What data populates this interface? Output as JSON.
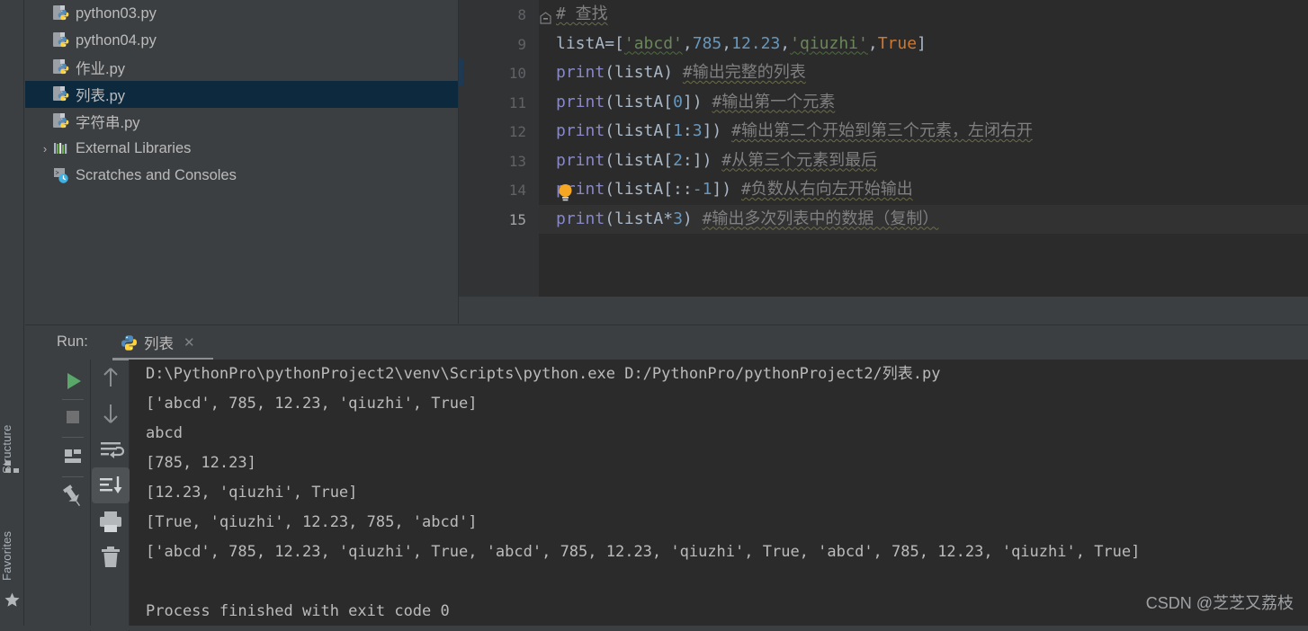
{
  "tool_strip": {
    "structure_label": "Structure",
    "favorites_label": "Favorites",
    "structure_icon": "structure-icon",
    "favorites_icon": "star-icon"
  },
  "project_tree": {
    "items": [
      {
        "label": "python03.py",
        "icon": "python-file-icon",
        "selected": false,
        "arrow": "",
        "indent": 0
      },
      {
        "label": "python04.py",
        "icon": "python-file-icon",
        "selected": false,
        "arrow": "",
        "indent": 0
      },
      {
        "label": "作业.py",
        "icon": "python-file-icon",
        "selected": false,
        "arrow": "",
        "indent": 0
      },
      {
        "label": "列表.py",
        "icon": "python-file-icon",
        "selected": true,
        "arrow": "",
        "indent": 0
      },
      {
        "label": "字符串.py",
        "icon": "python-file-icon",
        "selected": false,
        "arrow": "",
        "indent": 0
      },
      {
        "label": "External Libraries",
        "icon": "library-icon",
        "selected": false,
        "arrow": "›",
        "indent": 0
      },
      {
        "label": "Scratches and Consoles",
        "icon": "scratches-icon",
        "selected": false,
        "arrow": "",
        "indent": 0
      }
    ]
  },
  "editor": {
    "line_numbers": [
      "8",
      "9",
      "10",
      "11",
      "12",
      "13",
      "14",
      "15"
    ],
    "current_line": "15",
    "lines": [
      {
        "number": "8",
        "fold": true,
        "tokens": [
          {
            "t": "# 查找",
            "c": "k-cmt"
          }
        ]
      },
      {
        "number": "9",
        "fold": false,
        "tokens": [
          {
            "t": "listA",
            "c": "k-var"
          },
          {
            "t": "=",
            "c": "k-op"
          },
          {
            "t": "[",
            "c": "k-brk"
          },
          {
            "t": "'abcd'",
            "c": "k-str"
          },
          {
            "t": ",",
            "c": "k-op"
          },
          {
            "t": "785",
            "c": "k-num"
          },
          {
            "t": ",",
            "c": "k-op"
          },
          {
            "t": "12.23",
            "c": "k-num"
          },
          {
            "t": ",",
            "c": "k-op"
          },
          {
            "t": "'qiuzhi'",
            "c": "k-str"
          },
          {
            "t": ",",
            "c": "k-op"
          },
          {
            "t": "True",
            "c": "k-kw"
          },
          {
            "t": "]",
            "c": "k-brk"
          }
        ]
      },
      {
        "number": "10",
        "fold": false,
        "tokens": [
          {
            "t": "print",
            "c": "k-fn"
          },
          {
            "t": "(",
            "c": "k-brk"
          },
          {
            "t": "listA",
            "c": "k-var"
          },
          {
            "t": ")",
            "c": "k-brk"
          },
          {
            "t": " ",
            "c": "k-op"
          },
          {
            "t": "#输出完整的列表",
            "c": "k-cmt"
          }
        ]
      },
      {
        "number": "11",
        "fold": false,
        "tokens": [
          {
            "t": "print",
            "c": "k-fn"
          },
          {
            "t": "(",
            "c": "k-brk"
          },
          {
            "t": "listA",
            "c": "k-var"
          },
          {
            "t": "[",
            "c": "k-brk"
          },
          {
            "t": "0",
            "c": "k-num"
          },
          {
            "t": "])",
            "c": "k-brk"
          },
          {
            "t": " ",
            "c": "k-op"
          },
          {
            "t": "#输出第一个元素",
            "c": "k-cmt"
          }
        ]
      },
      {
        "number": "12",
        "fold": false,
        "tokens": [
          {
            "t": "print",
            "c": "k-fn"
          },
          {
            "t": "(",
            "c": "k-brk"
          },
          {
            "t": "listA",
            "c": "k-var"
          },
          {
            "t": "[",
            "c": "k-brk"
          },
          {
            "t": "1",
            "c": "k-num"
          },
          {
            "t": ":",
            "c": "k-op"
          },
          {
            "t": "3",
            "c": "k-num"
          },
          {
            "t": "])",
            "c": "k-brk"
          },
          {
            "t": " ",
            "c": "k-op"
          },
          {
            "t": "#输出第二个开始到第三个元素，左闭右开",
            "c": "k-cmt"
          }
        ]
      },
      {
        "number": "13",
        "fold": false,
        "tokens": [
          {
            "t": "print",
            "c": "k-fn"
          },
          {
            "t": "(",
            "c": "k-brk"
          },
          {
            "t": "listA",
            "c": "k-var"
          },
          {
            "t": "[",
            "c": "k-brk"
          },
          {
            "t": "2",
            "c": "k-num"
          },
          {
            "t": ":])",
            "c": "k-brk"
          },
          {
            "t": " ",
            "c": "k-op"
          },
          {
            "t": "#从第三个元素到最后",
            "c": "k-cmt"
          }
        ]
      },
      {
        "number": "14",
        "fold": false,
        "tokens": [
          {
            "t": "print",
            "c": "k-fn"
          },
          {
            "t": "(",
            "c": "k-brk"
          },
          {
            "t": "listA",
            "c": "k-var"
          },
          {
            "t": "[::",
            "c": "k-brk"
          },
          {
            "t": "-1",
            "c": "k-num"
          },
          {
            "t": "])",
            "c": "k-brk"
          },
          {
            "t": " ",
            "c": "k-op"
          },
          {
            "t": "#负数从右向左开始输出",
            "c": "k-cmt"
          }
        ]
      },
      {
        "number": "15",
        "fold": false,
        "tokens": [
          {
            "t": "print",
            "c": "k-fn"
          },
          {
            "t": "(",
            "c": "k-brk"
          },
          {
            "t": "listA",
            "c": "k-var"
          },
          {
            "t": "*",
            "c": "k-op"
          },
          {
            "t": "3",
            "c": "k-num"
          },
          {
            "t": ")",
            "c": "k-brk"
          },
          {
            "t": " ",
            "c": "k-op"
          },
          {
            "t": "#输出多次列表中的数据（复制）",
            "c": "k-cmt"
          }
        ]
      }
    ],
    "intention_bulb": "lightbulb-icon"
  },
  "run_panel": {
    "run_label": "Run:",
    "tab_name": "列表",
    "tab_icon": "python-icon",
    "close_icon": "close-icon",
    "toolbar_primary": [
      {
        "name": "rerun-button",
        "icon": "play-icon"
      },
      {
        "name": "stop-button",
        "icon": "stop-icon"
      },
      {
        "name": "restore-layout-button",
        "icon": "layout-icon"
      },
      {
        "name": "pin-tab-button",
        "icon": "pin-icon"
      }
    ],
    "toolbar_secondary": [
      {
        "name": "up-stacktrace-button",
        "icon": "arrow-up-icon"
      },
      {
        "name": "down-stacktrace-button",
        "icon": "arrow-down-icon"
      },
      {
        "name": "soft-wrap-button",
        "icon": "soft-wrap-icon"
      },
      {
        "name": "scroll-to-end-button",
        "icon": "scroll-to-end-icon",
        "active": true
      },
      {
        "name": "print-button",
        "icon": "printer-icon"
      },
      {
        "name": "clear-all-button",
        "icon": "trash-icon"
      }
    ],
    "console_lines": [
      "D:\\PythonPro\\pythonProject2\\venv\\Scripts\\python.exe D:/PythonPro/pythonProject2/列表.py",
      "['abcd', 785, 12.23, 'qiuzhi', True]",
      "abcd",
      "[785, 12.23]",
      "[12.23, 'qiuzhi', True]",
      "[True, 'qiuzhi', 12.23, 785, 'abcd']",
      "['abcd', 785, 12.23, 'qiuzhi', True, 'abcd', 785, 12.23, 'qiuzhi', True, 'abcd', 785, 12.23, 'qiuzhi', True]",
      "",
      "Process finished with exit code 0"
    ]
  },
  "watermark": "CSDN @芝芝又荔枝",
  "colors": {
    "panel_bg": "#3c3f41",
    "editor_bg": "#2b2b2b",
    "gutter_bg": "#313335",
    "selection_bg": "#0d293e",
    "text": "#bbbbbb",
    "string": "#6a8759",
    "number": "#6897bb",
    "keyword": "#cc7832",
    "comment": "#808080",
    "function": "#8888c6",
    "play_green": "#59a869"
  }
}
